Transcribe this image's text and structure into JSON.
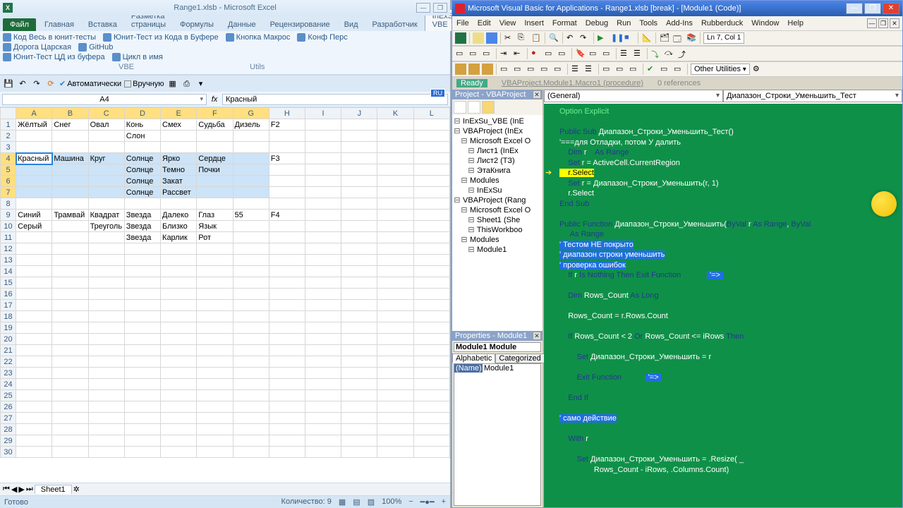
{
  "excel": {
    "title": "Range1.xlsb  -  Microsoft Excel",
    "tabs": [
      "Файл",
      "Главная",
      "Вставка",
      "Разметка страницы",
      "Формулы",
      "Данные",
      "Рецензирование",
      "Вид",
      "Разработчик",
      "InExSu VBE"
    ],
    "active_tab": 9,
    "addins_row1": [
      "Код Весь в юнит-тесты",
      "Юнит-Тест из Кода в Буфере",
      "Кнопка Макрос",
      "Конф Перс"
    ],
    "addins_row2": [
      "Дорога Царская",
      "GitHub"
    ],
    "addins_row3": [
      "Юнит-Тест ЦД из буфера",
      "Цикл в имя"
    ],
    "addin_groups": [
      "VBE",
      "Utils"
    ],
    "qat_auto": "Автоматически",
    "qat_manual": "Вручную",
    "namebox": "A4",
    "formula": "Красный",
    "columns": [
      "A",
      "B",
      "C",
      "D",
      "E",
      "F",
      "G",
      "H",
      "I",
      "J",
      "K",
      "L"
    ],
    "rows": [
      [
        "Жёлтый",
        "Снег",
        "Овал",
        "Конь",
        "Смех",
        "Судьба",
        "Дизель",
        "F2",
        "",
        "",
        "",
        ""
      ],
      [
        "",
        "",
        "",
        "Слон",
        "",
        "",
        "",
        "",
        "",
        "",
        "",
        ""
      ],
      [
        "",
        "",
        "",
        "",
        "",
        "",
        "",
        "",
        "",
        "",
        "",
        ""
      ],
      [
        "Красный",
        "Машина",
        "Круг",
        "Солнце",
        "Ярко",
        "Сердце",
        "",
        "F3",
        "",
        "",
        "",
        ""
      ],
      [
        "",
        "",
        "",
        "Солнце",
        "Темно",
        "Почки",
        "",
        "",
        "",
        "",
        "",
        ""
      ],
      [
        "",
        "",
        "",
        "Солнце",
        "Закат",
        "",
        "",
        "",
        "",
        "",
        "",
        ""
      ],
      [
        "",
        "",
        "",
        "Солнце",
        "Рассвет",
        "",
        "",
        "",
        "",
        "",
        "",
        ""
      ],
      [
        "",
        "",
        "",
        "",
        "",
        "",
        "",
        "",
        "",
        "",
        "",
        ""
      ],
      [
        "Синий",
        "Трамвай",
        "Квадрат",
        "Звезда",
        "Далеко",
        "Глаз",
        "55",
        "F4",
        "",
        "",
        "",
        ""
      ],
      [
        "Серый",
        "",
        "Треуголь",
        "Звезда",
        "Близко",
        "Язык",
        "",
        "",
        "",
        "",
        "",
        ""
      ],
      [
        "",
        "",
        "",
        "Звезда",
        "Карлик",
        "Рот",
        "",
        "",
        "",
        "",
        "",
        ""
      ],
      [
        "",
        "",
        "",
        "",
        "",
        "",
        "",
        "",
        "",
        "",
        "",
        ""
      ]
    ],
    "extra_rows": 18,
    "selection": {
      "r1": 4,
      "r2": 7,
      "c1": 1,
      "c2": 7,
      "active": "A4"
    },
    "sheet": "Sheet1",
    "status_left": "Готово",
    "status_count_label": "Количество:",
    "status_count": "9",
    "zoom": "100%",
    "lang": "RU"
  },
  "vbe": {
    "title": "Microsoft Visual Basic for Applications - Range1.xlsb [break] - [Module1 (Code)]",
    "menus": [
      "File",
      "Edit",
      "View",
      "Insert",
      "Format",
      "Debug",
      "Run",
      "Tools",
      "Add-Ins",
      "Rubberduck",
      "Window",
      "Help"
    ],
    "cursor_pos": "Ln 7, Col 1",
    "rd_status": "Ready",
    "rd_proc": "VBAProject.Module1.Macro1 (procedure)",
    "rd_refs": "0 references",
    "other_utilities": "Other Utilities",
    "project_title": "Project - VBAProject",
    "tree": [
      {
        "d": 0,
        "t": "InExSu_VBE (InE"
      },
      {
        "d": 0,
        "t": "VBAProject (InEx"
      },
      {
        "d": 1,
        "t": "Microsoft Excel O"
      },
      {
        "d": 2,
        "t": "Лист1 (InEx"
      },
      {
        "d": 2,
        "t": "Лист2 (ТЗ)"
      },
      {
        "d": 2,
        "t": "ЭтаКнига"
      },
      {
        "d": 1,
        "t": "Modules"
      },
      {
        "d": 2,
        "t": "InExSu"
      },
      {
        "d": 0,
        "t": "VBAProject (Rang"
      },
      {
        "d": 1,
        "t": "Microsoft Excel O"
      },
      {
        "d": 2,
        "t": "Sheet1 (She"
      },
      {
        "d": 2,
        "t": "ThisWorkboo"
      },
      {
        "d": 1,
        "t": "Modules"
      },
      {
        "d": 2,
        "t": "Module1"
      }
    ],
    "props_title": "Properties - Module1",
    "props_combo": "Module1 Module",
    "props_tab_a": "Alphabetic",
    "props_tab_c": "Categorized",
    "props_name_k": "(Name)",
    "props_name_v": "Module1",
    "combo_left": "(General)",
    "combo_right": "Диапазон_Строки_Уменьшить_Тест",
    "code_lines": [
      {
        "t": "Option Explicit",
        "cls": "opt"
      },
      {
        "t": ""
      },
      {
        "t": "Public Sub Диапазон_Строки_Уменьшить_Тест()"
      },
      {
        "t": "'===для Отладки, потом У далить",
        "cls": "cm"
      },
      {
        "t": "    Dim r    As Range"
      },
      {
        "t": "    Set r = ActiveCell.CurrentRegion"
      },
      {
        "t": "    r.Select",
        "hl": "yellow",
        "arrow": true
      },
      {
        "t": "    Set r = Диапазон_Строки_Уменьшить(r, 1)"
      },
      {
        "t": "    r.Select"
      },
      {
        "t": "End Sub"
      },
      {
        "t": ""
      },
      {
        "t": "Public Function Диапазон_Строки_Уменьшить(ByVal r As Range, ByVal"
      },
      {
        "t": "     As Range"
      },
      {
        "t": "' Тестом НЕ покрыто",
        "hl": "blue"
      },
      {
        "t": "' диапазон строки уменьшить",
        "hl": "blue"
      },
      {
        "t": "' проверка ошибок",
        "hl": "blue"
      },
      {
        "t": "    If r Is Nothing Then Exit Function           ",
        "badge": "'=>"
      },
      {
        "t": ""
      },
      {
        "t": "    Dim Rows_Count As Long"
      },
      {
        "t": ""
      },
      {
        "t": "    Rows_Count = r.Rows.Count"
      },
      {
        "t": ""
      },
      {
        "t": "    If Rows_Count < 2 Or Rows_Count <= iRows Then"
      },
      {
        "t": ""
      },
      {
        "t": "        Set Диапазон_Строки_Уменьшить = r"
      },
      {
        "t": ""
      },
      {
        "t": "        Exit Function          ",
        "badge": "'=>"
      },
      {
        "t": ""
      },
      {
        "t": "    End If"
      },
      {
        "t": ""
      },
      {
        "t": "' само действие",
        "hl": "blue"
      },
      {
        "t": ""
      },
      {
        "t": "    With r"
      },
      {
        "t": ""
      },
      {
        "t": "        Set Диапазон_Строки_Уменьшить = .Resize( _"
      },
      {
        "t": "                Rows_Count - iRows, .Columns.Count)"
      }
    ]
  }
}
